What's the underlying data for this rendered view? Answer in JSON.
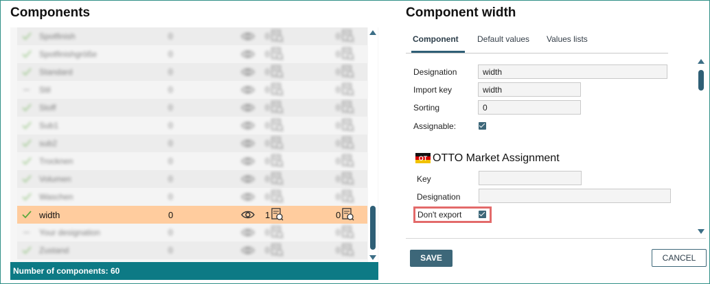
{
  "left": {
    "title": "Components",
    "status": "Number of components: 60",
    "rows": [
      {
        "name": "Spotfinish",
        "count": "0",
        "n1": "0",
        "n2": "0",
        "check": "check"
      },
      {
        "name": "Spotfinishgröße",
        "count": "0",
        "n1": "0",
        "n2": "0",
        "check": "check"
      },
      {
        "name": "Standard",
        "count": "0",
        "n1": "0",
        "n2": "0",
        "check": "check"
      },
      {
        "name": "Stil",
        "count": "0",
        "n1": "0",
        "n2": "0",
        "check": "dash"
      },
      {
        "name": "Stoff",
        "count": "0",
        "n1": "0",
        "n2": "0",
        "check": "check"
      },
      {
        "name": "Sub1",
        "count": "0",
        "n1": "0",
        "n2": "0",
        "check": "check"
      },
      {
        "name": "sub2",
        "count": "0",
        "n1": "0",
        "n2": "0",
        "check": "check"
      },
      {
        "name": "Trocknen",
        "count": "0",
        "n1": "0",
        "n2": "0",
        "check": "check"
      },
      {
        "name": "Volumen",
        "count": "0",
        "n1": "0",
        "n2": "0",
        "check": "check"
      },
      {
        "name": "Waschen",
        "count": "0",
        "n1": "0",
        "n2": "0",
        "check": "check"
      },
      {
        "name": "width",
        "count": "0",
        "n1": "1",
        "n2": "0",
        "check": "check",
        "selected": true
      },
      {
        "name": "Your designation",
        "count": "0",
        "n1": "0",
        "n2": "0",
        "check": "dash"
      },
      {
        "name": "Zustand",
        "count": "0",
        "n1": "0",
        "n2": "0",
        "check": "check"
      }
    ]
  },
  "right": {
    "title": "Component width",
    "tabs": [
      "Component",
      "Default values",
      "Values lists"
    ],
    "form": {
      "designation_label": "Designation",
      "designation_value": "width",
      "import_key_label": "Import key",
      "import_key_value": "width",
      "sorting_label": "Sorting",
      "sorting_value": "0",
      "assignable_label": "Assignable:",
      "assignable_checked": true
    },
    "otto": {
      "flag_text": "OT",
      "section_title": "OTTO Market Assignment",
      "key_label": "Key",
      "key_value": "",
      "designation_label": "Designation",
      "designation_value": "",
      "dont_export_label": "Don't export",
      "dont_export_checked": true
    },
    "buttons": {
      "save": "SAVE",
      "cancel": "CANCEL"
    }
  },
  "colors": {
    "accent": "#3d6779",
    "status_bar": "#0d7a85",
    "selected_row": "#ffcc9e",
    "check_green": "#5aa83c",
    "highlight_red": "#e36a6a"
  }
}
